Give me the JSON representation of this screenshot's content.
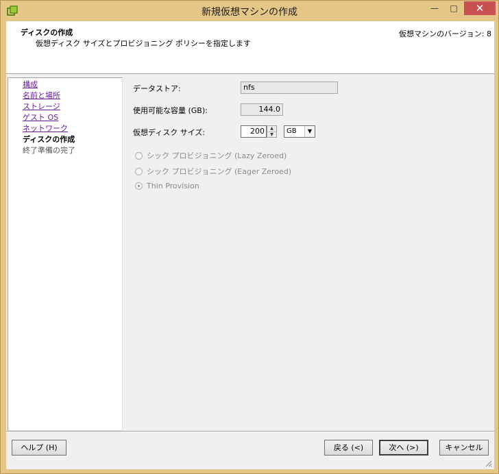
{
  "window": {
    "title": "新規仮想マシンの作成",
    "minimize_label": "—",
    "maximize_label": "□",
    "close_label": "✕"
  },
  "header": {
    "title": "ディスクの作成",
    "subtitle": "仮想ディスク サイズとプロビジョニング ポリシーを指定します",
    "version_label": "仮想マシンのバージョン: 8"
  },
  "nav": {
    "items": [
      {
        "label": "構成",
        "state": "link"
      },
      {
        "label": "名前と場所",
        "state": "link"
      },
      {
        "label": "ストレージ",
        "state": "link"
      },
      {
        "label": "ゲスト OS",
        "state": "link"
      },
      {
        "label": "ネットワーク",
        "state": "link"
      },
      {
        "label": "ディスクの作成",
        "state": "current"
      },
      {
        "label": "終了準備の完了",
        "state": "pending"
      }
    ]
  },
  "form": {
    "datastore_label": "データストア:",
    "datastore_value": "nfs",
    "capacity_label": "使用可能な容量 (GB):",
    "capacity_value": "144.0",
    "disk_size_label": "仮想ディスク サイズ:",
    "disk_size_value": "200",
    "disk_size_unit": "GB",
    "provisioning": [
      {
        "label": "シック プロビジョニング (Lazy Zeroed)",
        "selected": false
      },
      {
        "label": "シック プロビジョニング (Eager Zeroed)",
        "selected": false
      },
      {
        "label": "Thin Provision",
        "selected": true
      }
    ]
  },
  "buttons": {
    "help": "ヘルプ (H)",
    "back": "戻る (<)",
    "next": "次へ (>)",
    "cancel": "キャンセル"
  },
  "icons": {
    "app": "vmware-vm-icon",
    "spin_up": "spin-up-icon",
    "spin_down": "spin-down-icon",
    "dropdown": "dropdown-arrow-icon",
    "resize": "resize-grip-icon"
  }
}
